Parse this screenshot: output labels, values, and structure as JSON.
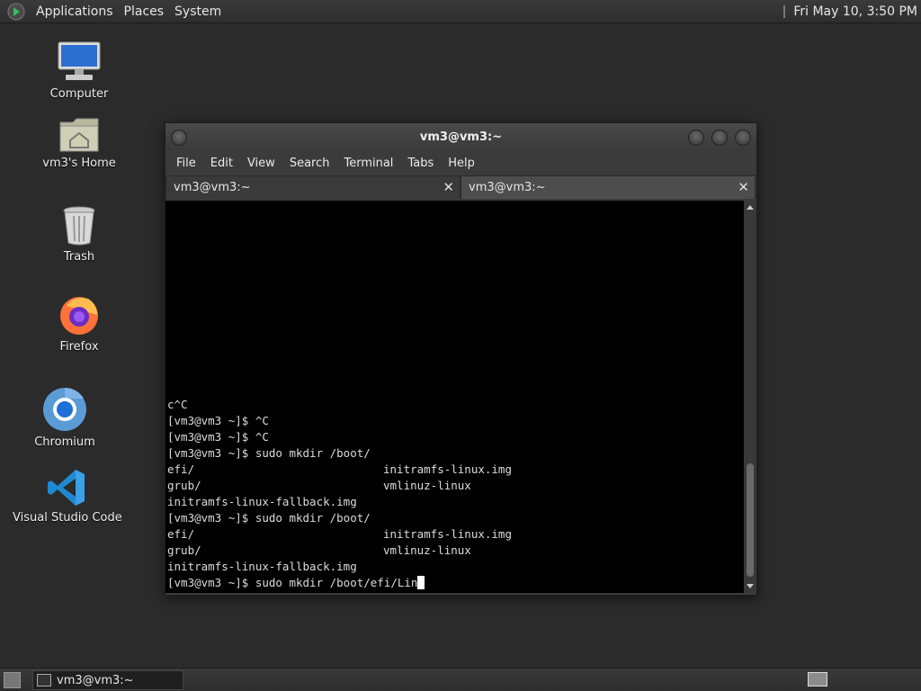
{
  "top_panel": {
    "menus": [
      "Applications",
      "Places",
      "System"
    ],
    "clock": "Fri May 10,  3:50 PM"
  },
  "desktop": {
    "icons": [
      {
        "label": "Computer",
        "icon": "computer-icon"
      },
      {
        "label": "vm3's Home",
        "icon": "home-folder-icon"
      },
      {
        "label": "Trash",
        "icon": "trash-icon"
      },
      {
        "label": "Firefox",
        "icon": "firefox-icon"
      },
      {
        "label": "Chromium",
        "icon": "chromium-icon"
      },
      {
        "label": "Visual Studio Code",
        "icon": "vscode-icon"
      }
    ]
  },
  "window": {
    "title": "vm3@vm3:~",
    "menu": [
      "File",
      "Edit",
      "View",
      "Search",
      "Terminal",
      "Tabs",
      "Help"
    ],
    "tabs": [
      {
        "label": "vm3@vm3:~",
        "active": true
      },
      {
        "label": "vm3@vm3:~",
        "active": false
      }
    ]
  },
  "terminal": {
    "lines": [
      {
        "a": "c^C",
        "b": ""
      },
      {
        "a": "[vm3@vm3 ~]$ ^C",
        "b": ""
      },
      {
        "a": "[vm3@vm3 ~]$ ^C",
        "b": ""
      },
      {
        "a": "[vm3@vm3 ~]$ sudo mkdir /boot/",
        "b": ""
      },
      {
        "a": "efi/",
        "b": "initramfs-linux.img"
      },
      {
        "a": "grub/",
        "b": "vmlinuz-linux"
      },
      {
        "a": "initramfs-linux-fallback.img",
        "b": ""
      },
      {
        "a": "[vm3@vm3 ~]$ sudo mkdir /boot/",
        "b": ""
      },
      {
        "a": "efi/",
        "b": "initramfs-linux.img"
      },
      {
        "a": "grub/",
        "b": "vmlinuz-linux"
      },
      {
        "a": "initramfs-linux-fallback.img",
        "b": ""
      }
    ],
    "current_input": "[vm3@vm3 ~]$ sudo mkdir /boot/efi/Lin"
  },
  "bottom_panel": {
    "task_label": "vm3@vm3:~"
  }
}
